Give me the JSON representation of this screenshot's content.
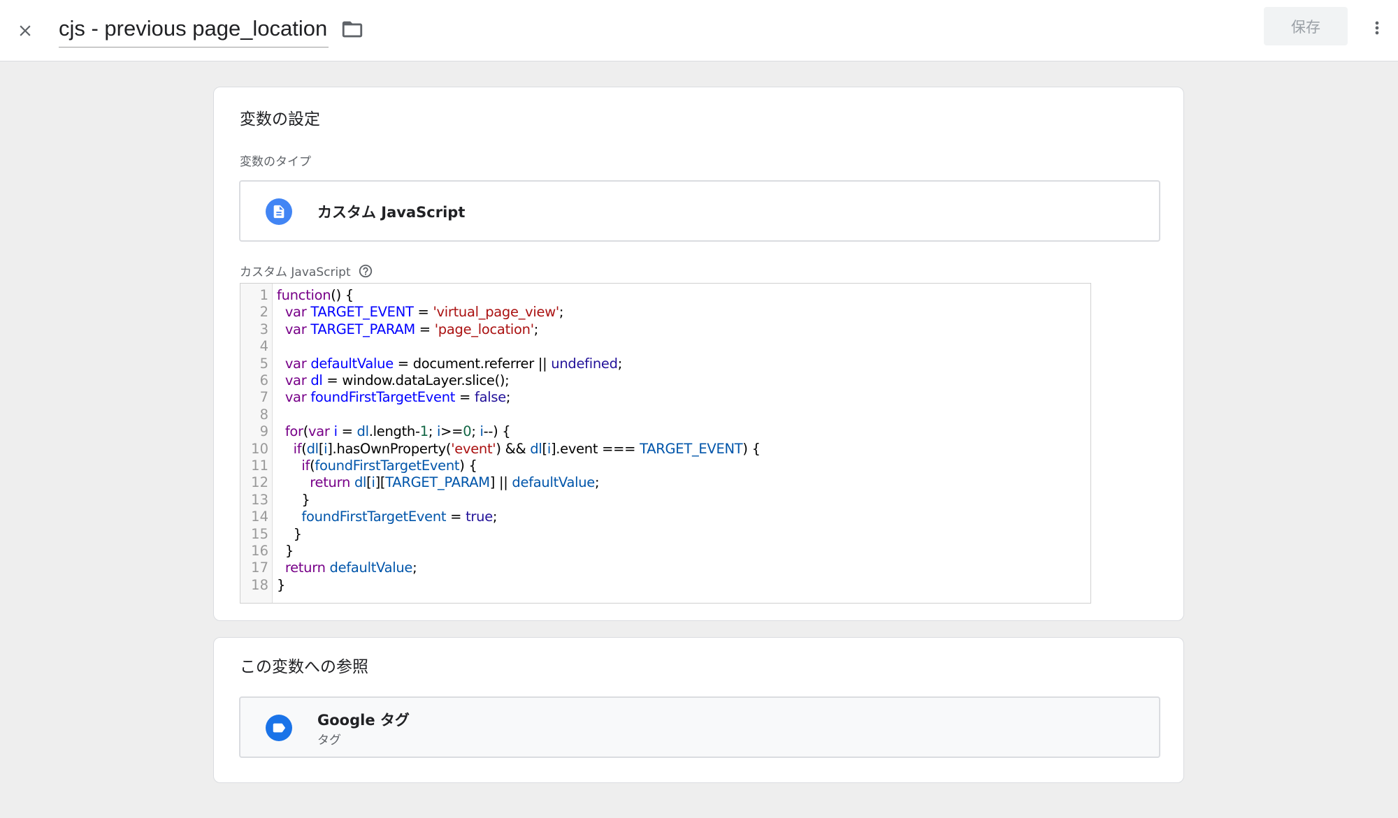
{
  "header": {
    "close_icon": "close-icon",
    "title": "cjs - previous page_location",
    "folder_icon": "folder-icon",
    "save_label": "保存",
    "more_icon": "more-vert-icon"
  },
  "config": {
    "title": "変数の設定",
    "type_label": "変数のタイプ",
    "type_value": "カスタム JavaScript",
    "type_icon": "document-icon",
    "code_label": "カスタム JavaScript",
    "help_icon": "help-icon",
    "code": {
      "line_numbers": [
        "1",
        "2",
        "3",
        "4",
        "5",
        "6",
        "7",
        "8",
        "9",
        "10",
        "11",
        "12",
        "13",
        "14",
        "15",
        "16",
        "17",
        "18"
      ],
      "l1": {
        "a": "function",
        "b": "() {"
      },
      "l2": {
        "i": "  ",
        "a": "var",
        "b": " ",
        "c": "TARGET_EVENT",
        "d": " = ",
        "e": "'virtual_page_view'",
        "f": ";"
      },
      "l3": {
        "i": "  ",
        "a": "var",
        "b": " ",
        "c": "TARGET_PARAM",
        "d": " = ",
        "e": "'page_location'",
        "f": ";"
      },
      "l5": {
        "i": "  ",
        "a": "var",
        "b": " ",
        "c": "defaultValue",
        "d": " = document.referrer || ",
        "e": "undefined",
        "f": ";"
      },
      "l6": {
        "i": "  ",
        "a": "var",
        "b": " ",
        "c": "dl",
        "d": " = window.dataLayer.slice();"
      },
      "l7": {
        "i": "  ",
        "a": "var",
        "b": " ",
        "c": "foundFirstTargetEvent",
        "d": " = ",
        "e": "false",
        "f": ";"
      },
      "l9": {
        "i": "  ",
        "a": "for",
        "b": "(",
        "c": "var",
        "d": " ",
        "e": "i",
        "f": " = ",
        "g": "dl",
        "h": ".length-",
        "j": "1",
        "k": "; ",
        "l": "i",
        "m": ">=",
        "n": "0",
        "o": "; ",
        "p": "i",
        "q": "--) {"
      },
      "l10": {
        "i": "    ",
        "a": "if",
        "b": "(",
        "c": "dl",
        "d": "[",
        "e": "i",
        "f": "].hasOwnProperty(",
        "g": "'event'",
        "h": ") && ",
        "j": "dl",
        "k": "[",
        "l": "i",
        "m": "].event === ",
        "n": "TARGET_EVENT",
        "o": ") {"
      },
      "l11": {
        "i": "      ",
        "a": "if",
        "b": "(",
        "c": "foundFirstTargetEvent",
        "d": ") {"
      },
      "l12": {
        "i": "        ",
        "a": "return",
        "b": " ",
        "c": "dl",
        "d": "[",
        "e": "i",
        "f": "][",
        "g": "TARGET_PARAM",
        "h": "] || ",
        "j": "defaultValue",
        "k": ";"
      },
      "l13": {
        "i": "      ",
        "a": "}"
      },
      "l14": {
        "i": "      ",
        "a": "foundFirstTargetEvent",
        "b": " = ",
        "c": "true",
        "d": ";"
      },
      "l15": {
        "i": "    ",
        "a": "}"
      },
      "l16": {
        "i": "  ",
        "a": "}"
      },
      "l17": {
        "i": "  ",
        "a": "return",
        "b": " ",
        "c": "defaultValue",
        "d": ";"
      },
      "l18": {
        "a": "}"
      }
    }
  },
  "references": {
    "title": "この変数への参照",
    "items": [
      {
        "name": "Google タグ",
        "type": "タグ",
        "icon": "tag-icon"
      }
    ]
  },
  "colors": {
    "keyword": "#770088",
    "variable_def": "#0000ff",
    "variable": "#0055aa",
    "string": "#aa1111",
    "number": "#116644",
    "atom": "#221199",
    "accent": "#4285f4"
  }
}
